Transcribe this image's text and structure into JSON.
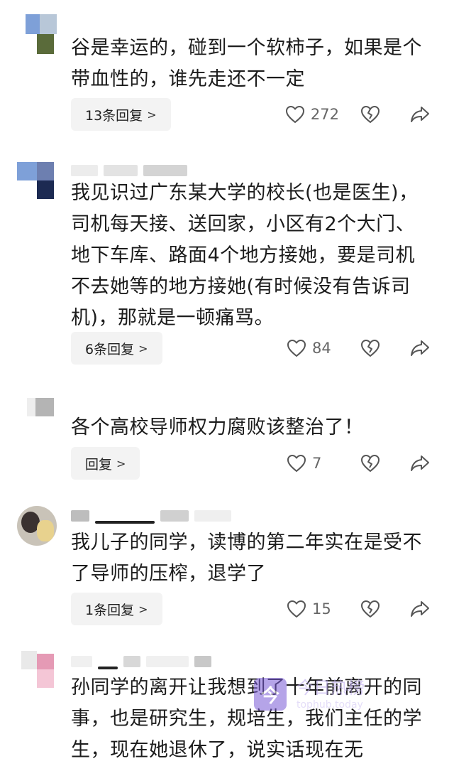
{
  "comments": [
    {
      "text": "谷是幸运的，碰到一个软柿子，如果是个带血性的，谁先走还不一定",
      "reply_label": "13条回复",
      "likes": "272"
    },
    {
      "text": "我见识过广东某大学的校长(也是医生)，司机每天接、送回家，小区有2个大门、地下车库、路面4个地方接她，要是司机不去她等的地方接她(有时候没有告诉司机)，那就是一顿痛骂。",
      "reply_label": "6条回复",
      "likes": "84"
    },
    {
      "text": "各个高校导师权力腐败该整治了！",
      "reply_label": "回复",
      "likes": "7"
    },
    {
      "text": "我儿子的同学，读博的第二年实在是受不了导师的压榨，退学了",
      "reply_label": "1条回复",
      "likes": "15"
    },
    {
      "text": "孙同学的离开让我想到了十年前离开的同事，也是研究生，规培生，我们主任的学生，现在她退休了，说实话现在无"
    }
  ],
  "icons": {
    "like": "heart-outline-icon",
    "dislike": "broken-heart-icon",
    "share": "share-arrow-icon",
    "chevron": "chevron-right-icon"
  },
  "watermark": {
    "logo_char": "今",
    "name": "今日热榜",
    "url": "tophub.today"
  },
  "colors": {
    "text": "#1c1c1c",
    "muted": "#666666",
    "reply_bg": "#f3f3f3",
    "watermark_purple": "#7a5bd6"
  }
}
